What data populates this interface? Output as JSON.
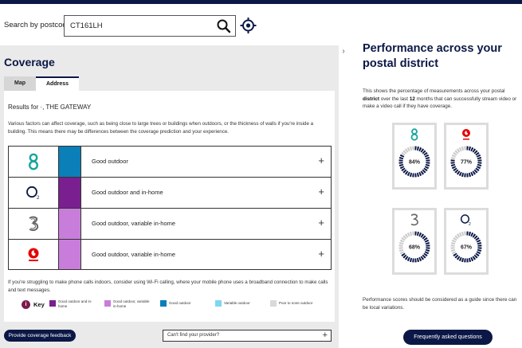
{
  "search": {
    "label": "Search by postcode",
    "value": "CT161LH"
  },
  "coverage": {
    "title": "Coverage",
    "collapse_glyph": "›",
    "tabs": [
      {
        "label": "Map",
        "active": false
      },
      {
        "label": "Address",
        "active": true
      }
    ],
    "results_for": "Results for ·, THE GATEWAY",
    "factors_text": "Various factors can affect coverage, such as being close to large trees or buildings when outdoors, or the thickness of walls if you're inside a building. This means there may be differences between the coverage prediction and your experience.",
    "networks": [
      {
        "logo": "ee-logo",
        "swatch_color": "#0a7fb8",
        "status": "Good outdoor"
      },
      {
        "logo": "o2-logo",
        "swatch_color": "#7a1f8f",
        "status": "Good outdoor and in-home"
      },
      {
        "logo": "three-logo",
        "swatch_color": "#c97ddb",
        "status": "Good outdoor, variable in-home"
      },
      {
        "logo": "vodafone-logo",
        "swatch_color": "#c97ddb",
        "status": "Good outdoor, variable in-home"
      }
    ],
    "wifi_note": "If you're struggling to make phone calls indoors, consider using Wi-Fi calling, where your mobile phone uses a broadband connection to make calls and text messages.",
    "key": {
      "icon_glyph": "i",
      "label": "Key",
      "items": [
        {
          "color": "#7a1f8f",
          "text": "Good outdoor and in-home"
        },
        {
          "color": "#c97ddb",
          "text": "Good outdoor, variable in-home"
        },
        {
          "color": "#0a7fb8",
          "text": "Good outdoor"
        },
        {
          "color": "#7fd6f0",
          "text": "Variable outdoor"
        },
        {
          "color": "#d9d9d9",
          "text": "Poor to none outdoor"
        }
      ]
    },
    "feedback_label": "Provide coverage feedback",
    "provider_placeholder": "Can't find your provider?",
    "plus_glyph": "+"
  },
  "performance": {
    "title": "Performance across your postal district",
    "desc_before": "This shows the percentage of measurements across your postal ",
    "desc_bold1": "district",
    "desc_mid": " over the last ",
    "desc_bold2": "12",
    "desc_after": " months that can successfully stream video or make a video call if they have coverage.",
    "gauges": [
      {
        "logo": "ee-logo",
        "label": "84%",
        "value": 84
      },
      {
        "logo": "vodafone-logo",
        "label": "77%",
        "value": 77
      },
      {
        "logo": "three-logo",
        "label": "68%",
        "value": 68
      },
      {
        "logo": "o2-logo",
        "label": "67%",
        "value": 67
      }
    ],
    "note": "Performance scores should be considered as a guide since there can be local variations.",
    "faq_label": "Frequently asked questions"
  },
  "colors": {
    "navy": "#0b1846",
    "gauge_fill": "#0b1846",
    "gauge_track": "#c9c9c9"
  }
}
